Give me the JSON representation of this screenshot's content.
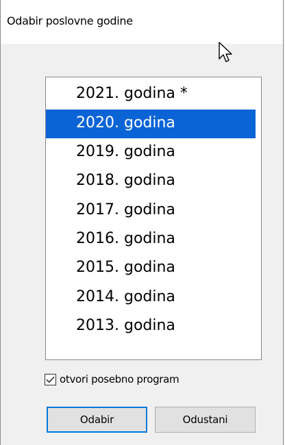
{
  "dialog": {
    "title": "Odabir poslovne godine"
  },
  "year_list": {
    "items": [
      {
        "label": "2021. godina *",
        "selected": false
      },
      {
        "label": "2020. godina",
        "selected": true
      },
      {
        "label": "2019. godina",
        "selected": false
      },
      {
        "label": "2018. godina",
        "selected": false
      },
      {
        "label": "2017. godina",
        "selected": false
      },
      {
        "label": "2016. godina",
        "selected": false
      },
      {
        "label": "2015. godina",
        "selected": false
      },
      {
        "label": "2014. godina",
        "selected": false
      },
      {
        "label": "2013. godina",
        "selected": false
      }
    ]
  },
  "options": {
    "open_separately_label": "otvori posebno program",
    "open_separately_checked": true
  },
  "buttons": {
    "ok_label": "Odabir",
    "cancel_label": "Odustani"
  },
  "colors": {
    "selection": "#0a64d6",
    "default_button_border": "#0078d7",
    "dialog_background": "#f0f0f0"
  },
  "icons": {
    "cursor": "mouse-pointer-icon",
    "checkbox": "checkmark-icon"
  }
}
